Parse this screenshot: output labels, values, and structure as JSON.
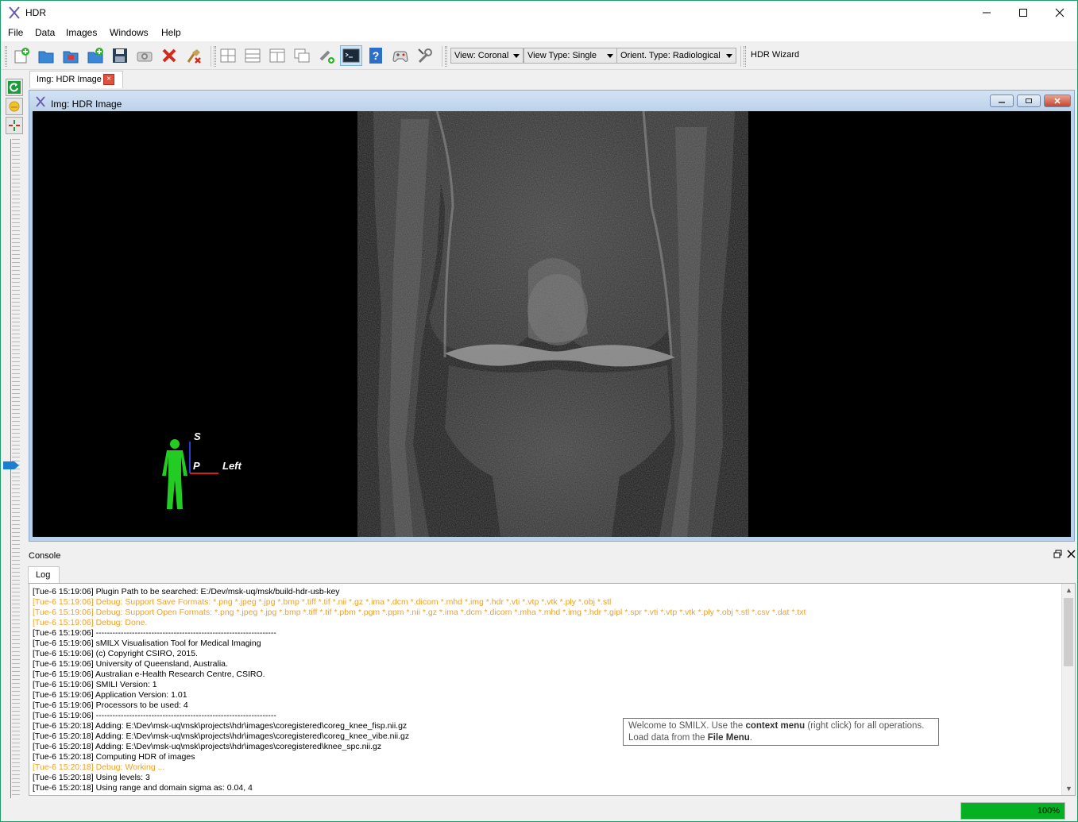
{
  "window": {
    "title": "HDR"
  },
  "menu": [
    "File",
    "Data",
    "Images",
    "Windows",
    "Help"
  ],
  "toolbar": {
    "view_combo": "View: Coronal",
    "view_type_combo": "View Type: Single",
    "orient_combo": "Orient. Type: Radiological",
    "wizard_label": "HDR Wizard"
  },
  "doc_tab": {
    "label": "Img: HDR Image"
  },
  "subwindow": {
    "title": "Img: HDR Image"
  },
  "orientation": {
    "superior": "S",
    "posterior": "P",
    "left": "Left"
  },
  "console": {
    "title": "Console",
    "tab": "Log",
    "lines": [
      {
        "text": "[Tue-6 15:19:06] Plugin Path to be searched: E:/Dev/msk-uq/msk/build-hdr-usb-key",
        "level": "info"
      },
      {
        "text": "[Tue-6 15:19:06] Debug: Support Save Formats: *.png *.jpeg *.jpg *.bmp *.tiff *.tif *.nii *.gz *.ima *.dcm *.dicom *.mhd *.img *.hdr *.vti *.vtp *.vtk *.ply *.obj *.stl",
        "level": "debug"
      },
      {
        "text": "[Tue-6 15:19:06] Debug: Support Open Formats: *.png *.jpeg *.jpg *.bmp *.tiff *.tif *.pbm *.pgm *.ppm *.nii *.gz *.ima *.dcm *.dicom *.mha *.mhd *.img *.hdr *.gipl *.spr *.vti *.vtp *.vtk *.ply *.obj *.stl *.csv *.dat *.txt",
        "level": "debug"
      },
      {
        "text": "[Tue-6 15:19:06] Debug: Done.",
        "level": "debug"
      },
      {
        "text": "[Tue-6 15:19:06] -----------------------------------------------------------------",
        "level": "info"
      },
      {
        "text": "[Tue-6 15:19:06] sMILX Visualisation Tool for Medical Imaging",
        "level": "info"
      },
      {
        "text": "[Tue-6 15:19:06] (c) Copyright CSIRO, 2015.",
        "level": "info"
      },
      {
        "text": "[Tue-6 15:19:06] University of Queensland, Australia.",
        "level": "info"
      },
      {
        "text": "[Tue-6 15:19:06] Australian e-Health Research Centre, CSIRO.",
        "level": "info"
      },
      {
        "text": "[Tue-6 15:19:06] SMILI Version: 1",
        "level": "info"
      },
      {
        "text": "[Tue-6 15:19:06] Application Version: 1.01",
        "level": "info"
      },
      {
        "text": "[Tue-6 15:19:06] Processors to be used: 4",
        "level": "info"
      },
      {
        "text": "[Tue-6 15:19:06] -----------------------------------------------------------------",
        "level": "info"
      },
      {
        "text": "[Tue-6 15:20:18] Adding: E:\\Dev\\msk-uq\\msk\\projects\\hdr\\images\\coregistered\\coreg_knee_fisp.nii.gz",
        "level": "info"
      },
      {
        "text": "[Tue-6 15:20:18] Adding: E:\\Dev\\msk-uq\\msk\\projects\\hdr\\images\\coregistered\\coreg_knee_vibe.nii.gz",
        "level": "info"
      },
      {
        "text": "[Tue-6 15:20:18] Adding: E:\\Dev\\msk-uq\\msk\\projects\\hdr\\images\\coregistered\\knee_spc.nii.gz",
        "level": "info"
      },
      {
        "text": "[Tue-6 15:20:18] Computing HDR of images",
        "level": "info"
      },
      {
        "text": "[Tue-6 15:20:18] Debug: Working ...",
        "level": "debug"
      },
      {
        "text": "[Tue-6 15:20:18] Using levels: 3",
        "level": "info"
      },
      {
        "text": "[Tue-6 15:20:18] Using range and domain sigma as: 0.04, 4",
        "level": "info"
      }
    ]
  },
  "tooltip": {
    "p1": "Welcome to SMILX. Use the ",
    "b1": "context menu",
    "p2": " (right click) for all operations.",
    "p3": "Load data from the ",
    "b2": "File Menu",
    "p4": "."
  },
  "progress": {
    "value": 1.0,
    "label": "100%"
  },
  "colors": {
    "debug": "#f4a022",
    "progress": "#06b025",
    "figure": "#22cc22"
  }
}
